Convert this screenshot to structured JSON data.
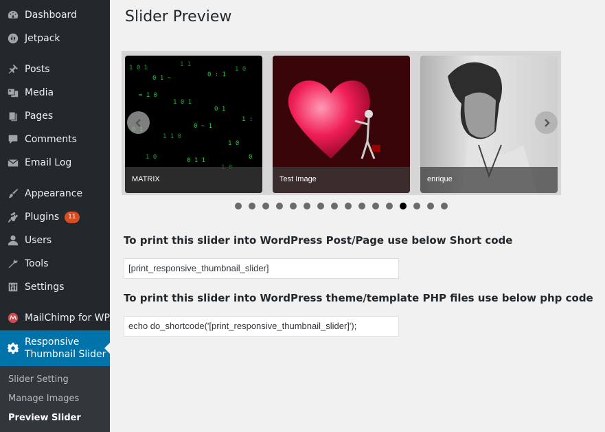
{
  "sidebar": {
    "items": [
      {
        "label": "Dashboard",
        "icon": "dashboard-icon"
      },
      {
        "label": "Jetpack",
        "icon": "jetpack-icon"
      },
      {
        "label": "Posts",
        "icon": "pin-icon"
      },
      {
        "label": "Media",
        "icon": "media-icon"
      },
      {
        "label": "Pages",
        "icon": "pages-icon"
      },
      {
        "label": "Comments",
        "icon": "comment-icon"
      },
      {
        "label": "Email Log",
        "icon": "email-icon"
      },
      {
        "label": "Appearance",
        "icon": "paintbrush-icon"
      },
      {
        "label": "Plugins",
        "icon": "plugin-icon",
        "badge": "11"
      },
      {
        "label": "Users",
        "icon": "user-icon"
      },
      {
        "label": "Tools",
        "icon": "wrench-icon"
      },
      {
        "label": "Settings",
        "icon": "settings-sliders-icon"
      },
      {
        "label": "MailChimp for WP",
        "icon": "mailchimp-icon"
      },
      {
        "label": "Responsive Thumbnail Slider",
        "icon": "gear-icon"
      }
    ],
    "submenu": [
      {
        "label": "Slider Setting"
      },
      {
        "label": "Manage Images"
      },
      {
        "label": "Preview Slider"
      }
    ]
  },
  "main": {
    "title": "Slider Preview",
    "slides": [
      {
        "caption": "MATRIX"
      },
      {
        "caption": "Test Image"
      },
      {
        "caption": "enrique"
      }
    ],
    "pagination": {
      "total": 16,
      "active_index": 12
    },
    "shortcode_heading": "To print this slider into WordPress Post/Page use below Short code",
    "shortcode_value": "[print_responsive_thumbnail_slider]",
    "php_heading": "To print this slider into WordPress theme/template PHP files use below php code",
    "php_value": "echo do_shortcode('[print_responsive_thumbnail_slider]');"
  },
  "colors": {
    "sidebar_bg": "#23282d",
    "submenu_bg": "#32373c",
    "accent": "#0073aa",
    "badge": "#d54e21",
    "page_bg": "#f1f1f1"
  }
}
